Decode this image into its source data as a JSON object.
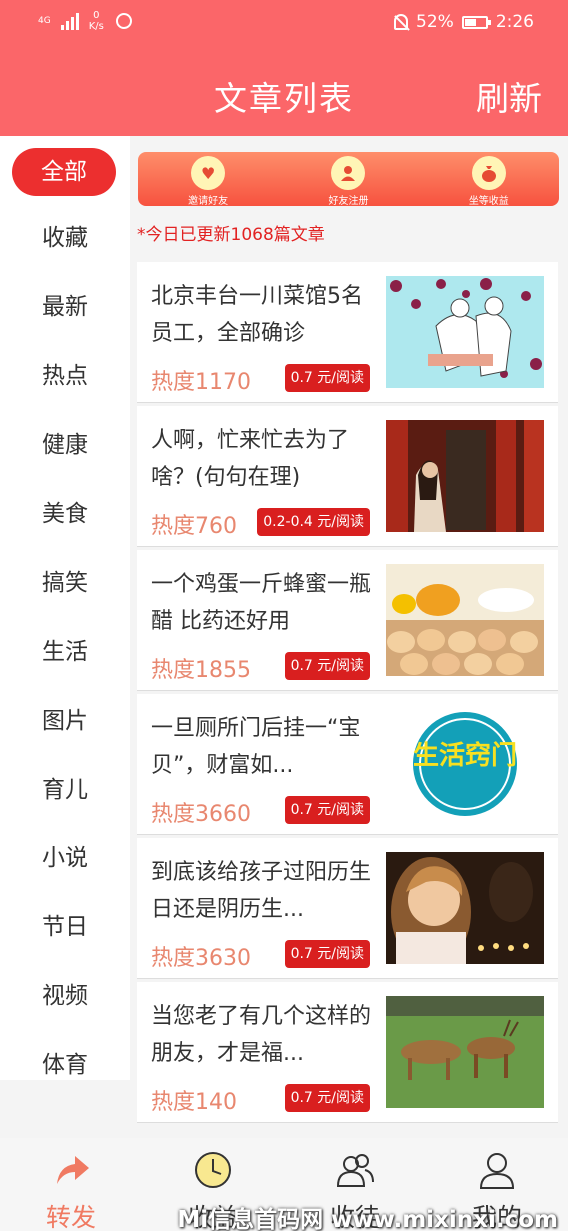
{
  "status": {
    "network": "4G",
    "speed_value": "0",
    "speed_unit": "K/s",
    "battery": "52%",
    "time": "2:26"
  },
  "header": {
    "title": "文章列表",
    "refresh": "刷新"
  },
  "categories": [
    "全部",
    "收藏",
    "最新",
    "热点",
    "健康",
    "美食",
    "搞笑",
    "生活",
    "图片",
    "育儿",
    "小说",
    "节日",
    "视频",
    "体育"
  ],
  "active_category": "全部",
  "banner": [
    {
      "label": "邀请好友",
      "icon": "heart-gift-icon"
    },
    {
      "label": "好友注册",
      "icon": "person-icon"
    },
    {
      "label": "坐等收益",
      "icon": "money-bag-icon"
    }
  ],
  "notice": "*今日已更新1068篇文章",
  "articles": [
    {
      "title": "北京丰台一川菜馆5名员工，全部确诊",
      "heat": "热度1170",
      "price": "0.7 元/阅读",
      "image": "virus-medics-illustration"
    },
    {
      "title": "人啊，忙来忙去为了啥？(句句在理)",
      "heat": "热度760",
      "price": "0.2-0.4 元/阅读",
      "image": "woman-in-temple-photo"
    },
    {
      "title": "一个鸡蛋一斤蜂蜜一瓶醋 比药还好用",
      "heat": "热度1855",
      "price": "0.7 元/阅读",
      "image": "honey-and-eggs-photo"
    },
    {
      "title": "一旦厕所门后挂一“宝贝”，财富如...",
      "heat": "热度3660",
      "price": "0.7 元/阅读",
      "image": "life-tips-logo"
    },
    {
      "title": "到底该给孩子过阳历生日还是阴历生...",
      "heat": "热度3630",
      "price": "0.7 元/阅读",
      "image": "child-birthday-candles-photo"
    },
    {
      "title": "当您老了有几个这样的朋友，才是福...",
      "heat": "热度140",
      "price": "0.7 元/阅读",
      "image": "deer-on-grass-photo"
    }
  ],
  "tabs": [
    {
      "label": "转发",
      "icon": "share-arrow-icon"
    },
    {
      "label": "收益",
      "icon": "clock-coin-icon"
    },
    {
      "label": "收徒",
      "icon": "apprentice-people-icon"
    },
    {
      "label": "我的",
      "icon": "user-profile-icon"
    }
  ],
  "logo_text": "生活窍门",
  "watermark": "Mi信息首码网 www.mixinxi.com",
  "colors": {
    "brand": "#fb6669",
    "accent": "#ec2f2f",
    "heat": "#e8876f",
    "price_bg": "#d91f1f"
  }
}
